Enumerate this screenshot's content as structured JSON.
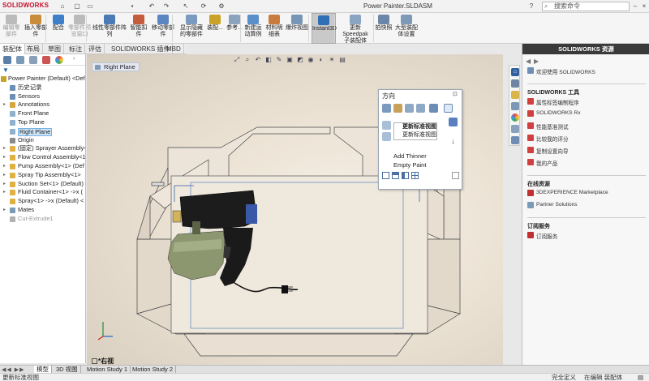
{
  "titlebar": {
    "logo": "SOLIDWORKS",
    "document_title": "Power Painter.SLDASM",
    "search_placeholder": "搜索命令"
  },
  "ribbon": {
    "buttons": [
      {
        "label": "编辑零\n部件",
        "dim": true
      },
      {
        "label": "插入零部件",
        "dim": false
      },
      {
        "label": "配合",
        "dim": false
      },
      {
        "label": "零部件预\n览窗口",
        "dim": true
      },
      {
        "label": "线性零部件阵列",
        "dim": false
      },
      {
        "label": "智能扣\n件",
        "dim": false
      },
      {
        "label": "移动零部件",
        "dim": false
      },
      {
        "label": "显示隐藏\n的零部件",
        "dim": false
      },
      {
        "label": "装配...",
        "dim": false
      },
      {
        "label": "参考...",
        "dim": false
      },
      {
        "label": "新建运\n动算例",
        "dim": false
      },
      {
        "label": "材料明\n细表",
        "dim": false
      },
      {
        "label": "爆炸视图",
        "dim": false
      },
      {
        "label": "Instant3D",
        "dim": false,
        "active": true
      },
      {
        "label": "更新\nSpeedpak\n子装配体",
        "dim": false
      },
      {
        "label": "拍快照",
        "dim": false
      },
      {
        "label": "大型装配\n体设置",
        "dim": false
      }
    ]
  },
  "tabs": [
    "装配体",
    "布局",
    "草图",
    "标注",
    "评估",
    "SOLIDWORKS 插件",
    "MBD"
  ],
  "tree": {
    "nodes": [
      {
        "label": "Power Painter (Default) <Def",
        "indent": 0,
        "arrow": "",
        "color": "#c9a227"
      },
      {
        "label": "历史记录",
        "indent": 1,
        "arrow": "",
        "color": "#6c8fb5"
      },
      {
        "label": "Sensors",
        "indent": 1,
        "arrow": "",
        "color": "#6c8fb5"
      },
      {
        "label": "Annotations",
        "indent": 1,
        "arrow": "▸",
        "color": "#d9a441"
      },
      {
        "label": "Front Plane",
        "indent": 1,
        "arrow": "",
        "color": "#8fb0cf"
      },
      {
        "label": "Top Plane",
        "indent": 1,
        "arrow": "",
        "color": "#8fb0cf"
      },
      {
        "label": "Right Plane",
        "indent": 1,
        "arrow": "",
        "color": "#8fb0cf",
        "selected": true
      },
      {
        "label": "Origin",
        "indent": 1,
        "arrow": "",
        "color": "#8a8a8a"
      },
      {
        "label": "(固定) Sprayer Assembly<",
        "indent": 1,
        "arrow": "▸",
        "color": "#e0b040"
      },
      {
        "label": "Flow Control Assembly<1",
        "indent": 1,
        "arrow": "▸",
        "color": "#e0b040"
      },
      {
        "label": "Pump Assembly<1> (Def",
        "indent": 1,
        "arrow": "▸",
        "color": "#e0b040"
      },
      {
        "label": "Spray Tip Assembly<1>",
        "indent": 1,
        "arrow": "▸",
        "color": "#e0b040"
      },
      {
        "label": "Suction Set<1> (Default)",
        "indent": 1,
        "arrow": "▸",
        "color": "#e0b040"
      },
      {
        "label": "Fluid Container<1> ->x (",
        "indent": 1,
        "arrow": "▸",
        "color": "#e0b040"
      },
      {
        "label": "Spray<1> ->x (Default) <",
        "indent": 1,
        "arrow": "",
        "color": "#e0b040"
      },
      {
        "label": "Mates",
        "indent": 1,
        "arrow": "▸",
        "color": "#7a9bb8"
      },
      {
        "label": "Cut-Extrude1",
        "indent": 1,
        "arrow": "",
        "color": "#b0b0b0",
        "grey": true
      }
    ]
  },
  "viewport": {
    "breadcrumb": "Right Plane",
    "view_label": "*右视"
  },
  "orientation_popup": {
    "title": "方向",
    "menu_items": [
      "更新标准视图",
      "更新标准视图"
    ],
    "items": [
      "Add Thinner",
      "Empty Paint"
    ]
  },
  "taskpane": {
    "header": "SOLIDWORKS 资源",
    "welcome": "欢迎使用 SOLIDWORKS",
    "tools_section": "SOLIDWORKS 工具",
    "tools": [
      {
        "label": "属性标签编制程序",
        "color": "#d04040"
      },
      {
        "label": "SOLIDWORKS Rx",
        "color": "#d04040"
      },
      {
        "label": "性能基准测试",
        "color": "#d04040"
      },
      {
        "label": "比较我的评分",
        "color": "#d04040"
      },
      {
        "label": "复制设置向导",
        "color": "#d04040"
      },
      {
        "label": "我的产品",
        "color": "#d04040"
      }
    ],
    "online_section": "在线资源",
    "online": [
      {
        "label": "3DEXPERIENCE Marketplace",
        "color": "#c03030"
      },
      {
        "label": "Partner Solutions",
        "color": "#7a9bb8"
      }
    ],
    "subscription_section": "订阅服务",
    "subscription": [
      {
        "label": "订阅服务",
        "color": "#c03030"
      }
    ]
  },
  "bottom_tabs": [
    "模型",
    "3D 视图",
    "Motion Study 1",
    "Motion Study 2"
  ],
  "status": {
    "left": "更新标准视图",
    "mid": "完全定义",
    "editing": "在编辑 装配体"
  }
}
